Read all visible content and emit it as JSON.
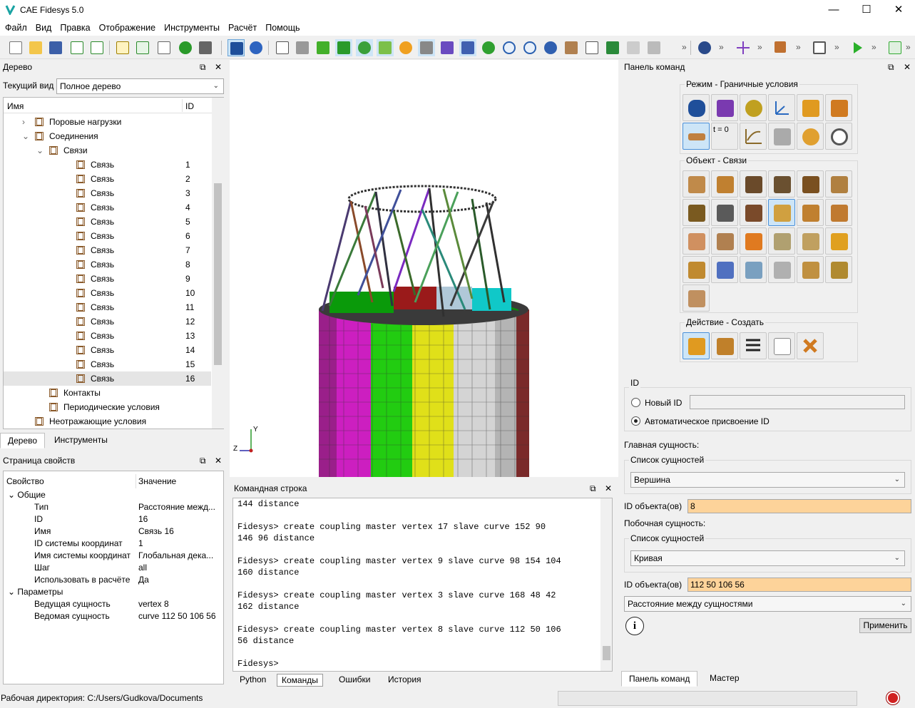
{
  "app": {
    "title": "CAE Fidesys 5.0"
  },
  "window_controls": {
    "minimize": "—",
    "maximize": "☐",
    "close": "✕"
  },
  "menu": [
    "Файл",
    "Вид",
    "Правка",
    "Отображение",
    "Инструменты",
    "Расчёт",
    "Помощь"
  ],
  "tree_panel": {
    "title": "Дерево",
    "view_label": "Текущий вид",
    "view_value": "Полное дерево",
    "col_name": "Имя",
    "col_id": "ID",
    "items": [
      {
        "label": "Поровые нагрузки",
        "level": 1,
        "expander": "›"
      },
      {
        "label": "Соединения",
        "level": 1,
        "expander": "⌄"
      },
      {
        "label": "Связи",
        "level": 2,
        "expander": "⌄"
      },
      {
        "label": "Связь",
        "id": "1"
      },
      {
        "label": "Связь",
        "id": "2"
      },
      {
        "label": "Связь",
        "id": "3"
      },
      {
        "label": "Связь",
        "id": "4"
      },
      {
        "label": "Связь",
        "id": "5"
      },
      {
        "label": "Связь",
        "id": "6"
      },
      {
        "label": "Связь",
        "id": "7"
      },
      {
        "label": "Связь",
        "id": "8"
      },
      {
        "label": "Связь",
        "id": "9"
      },
      {
        "label": "Связь",
        "id": "10"
      },
      {
        "label": "Связь",
        "id": "11"
      },
      {
        "label": "Связь",
        "id": "12"
      },
      {
        "label": "Связь",
        "id": "13"
      },
      {
        "label": "Связь",
        "id": "14"
      },
      {
        "label": "Связь",
        "id": "15"
      },
      {
        "label": "Связь",
        "id": "16"
      },
      {
        "label": "Контакты",
        "level": 2
      },
      {
        "label": "Периодические условия",
        "level": 2
      },
      {
        "label": "Неотражающие условия",
        "level": 1
      }
    ],
    "tabs": [
      "Дерево",
      "Инструменты"
    ]
  },
  "props_panel": {
    "title": "Страница свойств",
    "col_prop": "Свойство",
    "col_val": "Значение",
    "group_general": "Общие",
    "group_params": "Параметры",
    "general": [
      {
        "k": "Тип",
        "v": "Расстояние межд..."
      },
      {
        "k": "ID",
        "v": "16"
      },
      {
        "k": "Имя",
        "v": "Связь 16"
      },
      {
        "k": "ID системы координат",
        "v": "1"
      },
      {
        "k": "Имя системы координат",
        "v": "Глобальная дека..."
      },
      {
        "k": "Шаг",
        "v": "all"
      },
      {
        "k": "Использовать в расчёте",
        "v": "Да"
      }
    ],
    "params": [
      {
        "k": "Ведущая сущность",
        "v": "vertex 8"
      },
      {
        "k": "Ведомая сущность",
        "v": "curve 112 50 106 56"
      }
    ]
  },
  "viewport": {
    "axis_y": "Y",
    "axis_z": "Z"
  },
  "console": {
    "title": "Командная строка",
    "lines": [
      "144 distance",
      "",
      "Fidesys> create coupling master vertex 17 slave curve 152 90",
      "146 96 distance",
      "",
      "Fidesys> create coupling master vertex 9 slave curve 98 154 104",
      "160 distance",
      "",
      "Fidesys> create coupling master vertex 3 slave curve 168 48 42",
      "162 distance",
      "",
      "Fidesys> create coupling master vertex 8 slave curve 112 50 106",
      "56 distance",
      "",
      "Fidesys>"
    ],
    "tabs": [
      "Python",
      "Команды",
      "Ошибки",
      "История"
    ]
  },
  "cmd_panel": {
    "title": "Панель команд",
    "mode_group": "Режим - Граничные условия",
    "object_group": "Объект - Связи",
    "action_group": "Действие - Создать",
    "t0_label": "t = 0",
    "id_group": "ID",
    "new_id_label": "Новый ID",
    "auto_id_label": "Автоматическое присвоение ID",
    "master_label": "Главная сущность:",
    "entity_list_label": "Список сущностей",
    "master_entity": "Вершина",
    "master_ids_label": "ID объекта(ов)",
    "master_ids": "8",
    "slave_label": "Побочная сущность:",
    "slave_entity_list_label": "Список сущностей",
    "slave_entity": "Кривая",
    "slave_ids_label": "ID объекта(ов)",
    "slave_ids": "112 50 106 56",
    "method": "Расстояние между сущностями",
    "info_icon": "i",
    "apply": "Применить",
    "tabs": [
      "Панель команд",
      "Мастер"
    ]
  },
  "status": {
    "workdir": "Рабочая директория: C:/Users/Gudkova/Documents"
  }
}
